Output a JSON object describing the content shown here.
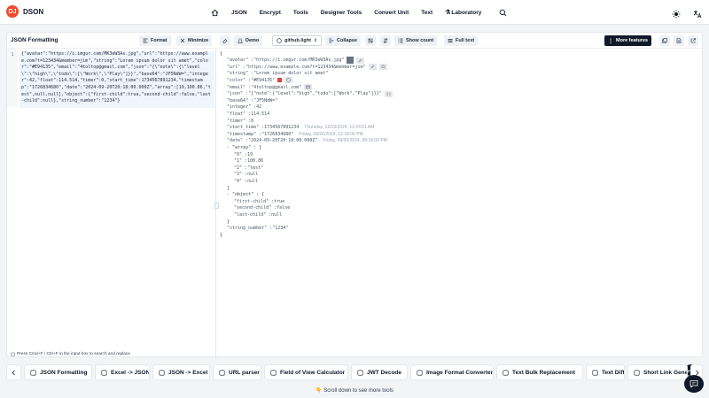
{
  "app": {
    "logo_mark": "DJ",
    "name": "DSON"
  },
  "nav": [
    "JSON",
    "Encrypt",
    "Tools",
    "Designer Tools",
    "Convert Unit",
    "Text",
    "Laboratory"
  ],
  "toolbar": {
    "title": "JSON Formatting",
    "format": "Format",
    "minimize": "Minimize",
    "demo": "Demo",
    "theme": "github.light",
    "collapse": "Collapse",
    "show_count": "Show count",
    "full_text": "Full text",
    "more": "More features"
  },
  "editor": {
    "line_number": "1",
    "code": "{\"avatar\":\"https://i.imgur.com/MK3eW3As.jpg\",\"url\":\"https://www.example.com?t=123434&member=jim\",\"string\":\"Lorem ipsum dolor sit amet\",\"color\":\"#E94135\",\"email\":\"4toltop@gmail.com\",\"json\":\"{\\\"note\\\":{\\\"level\\\":\\\"high\\\",\\\"todo\\\":[\\\"Work\\\",\\\"Play\\\"]}}\",\"base64\":\"JF5NdW=\",\"integer\":42,\"float\":114.514,\"timer\":0,\"start_time\":1734567891234,\"timestamp\":\"1726834680\",\"date\":\"2024-09-20T20:18:00.000Z\",\"array\":[19,100.86,\"test\",null,null],\"object\":{\"first-child\":true,\"second-child\":false,\"last-child\":null},\"string_number\":\"1234\"}",
    "hint": "Press Cmd+F / Ctrl+F in the input box to search and replace"
  },
  "tree": [
    {
      "t": "{",
      "indent": 0
    },
    {
      "k": "\"avatar\"",
      "v": "\"https://i.imgur.com/MK3eW3As.jpg\"",
      "extras": [
        "thumb",
        "link"
      ]
    },
    {
      "k": "\"url\"",
      "v": "\"https://www.example.com?t=123434&member=jim\"",
      "extras": [
        "link",
        "search"
      ]
    },
    {
      "k": "\"string\"",
      "v": "\"Lorem ipsum dolor sit amet\""
    },
    {
      "k": "\"color\"",
      "v": "\"#E94135\"",
      "extras": [
        "swatch",
        "palette"
      ]
    },
    {
      "k": "\"email\"",
      "v": "\"4toltop@gmail.com\"",
      "extras": [
        "mail"
      ]
    },
    {
      "k": "\"json\"",
      "v": "\"{\"note\":{\"level\":\"high\",\"todo\":[\"Work\",\"Play\"]}}\"",
      "extras": [
        "braces"
      ]
    },
    {
      "k": "\"base64\"",
      "v": "\"JF5NdW=\""
    },
    {
      "k": "\"integer\"",
      "v": "42"
    },
    {
      "k": "\"float\"",
      "v": "114.514"
    },
    {
      "k": "\"timer\"",
      "v": "0"
    },
    {
      "k": "\"start_time\"",
      "v": "1734567891234",
      "note": "Thursday, 12/19/2024, 12:24:51 AM"
    },
    {
      "k": "\"timestamp\"",
      "v": "\"1726834680\"",
      "note": "Friday, 09/20/2024, 12:18:00 PM"
    },
    {
      "k": "\"date\"",
      "v": "\"2024-09-20T20:18:00.000Z\"",
      "note": "Friday, 09/20/2024, 08:18:00 PM"
    },
    {
      "t": "- \"array\" : [",
      "indent": 1
    },
    {
      "k": "\"0\"",
      "v": "19",
      "indent": 2
    },
    {
      "k": "\"1\"",
      "v": "100.86",
      "indent": 2
    },
    {
      "k": "\"2\"",
      "v": "\"test\"",
      "indent": 2
    },
    {
      "k": "\"3\"",
      "v": "null",
      "indent": 2
    },
    {
      "k": "\"4\"",
      "v": "null",
      "indent": 2
    },
    {
      "t": "]",
      "indent": 1
    },
    {
      "t": "- \"object\" : {",
      "indent": 1
    },
    {
      "k": "\"first-child\"",
      "v": "true",
      "indent": 2
    },
    {
      "k": "\"second-child\"",
      "v": "false",
      "indent": 2
    },
    {
      "k": "\"last-child\"",
      "v": "null",
      "indent": 2
    },
    {
      "t": "}",
      "indent": 1
    },
    {
      "k": "\"string_number\"",
      "v": "\"1234\""
    },
    {
      "t": "}",
      "indent": 0
    }
  ],
  "tools": [
    "JSON Formatting",
    "Excel -> JSON",
    "JSON -> Excel",
    "URL parser",
    "Field of View Calculator",
    "JWT Decode",
    "Image Format Converter",
    "Text Bulk Replacement",
    "Text Diff",
    "Short Link Genera"
  ],
  "scroll_hint": "Scroll down to see more tools",
  "colors": {
    "accent": "#ef4a2a",
    "dark": "#111827",
    "swatch": "#E94135"
  }
}
